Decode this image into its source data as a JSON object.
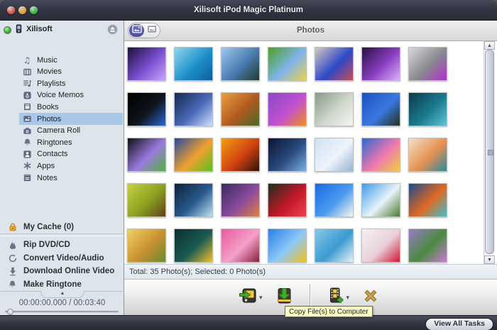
{
  "window": {
    "title": "Xilisoft iPod Magic Platinum",
    "traffic_lights": [
      {
        "name": "close",
        "color": "#e0504a"
      },
      {
        "name": "minimize",
        "color": "#dfa023"
      },
      {
        "name": "zoom",
        "color": "#35b436"
      }
    ]
  },
  "sidebar": {
    "device": {
      "name": "Xilisoft",
      "status_icon": "green-status-dot",
      "icon": "ipod-icon",
      "eject_icon": "eject-icon"
    },
    "items": [
      {
        "label": "Music",
        "icon": "music-icon",
        "selected": false
      },
      {
        "label": "Movies",
        "icon": "movies-icon",
        "selected": false
      },
      {
        "label": "Playlists",
        "icon": "playlists-icon",
        "selected": false
      },
      {
        "label": "Voice Memos",
        "icon": "voice-memos-icon",
        "selected": false
      },
      {
        "label": "Books",
        "icon": "books-icon",
        "selected": false
      },
      {
        "label": "Photos",
        "icon": "photos-icon",
        "selected": true
      },
      {
        "label": "Camera Roll",
        "icon": "camera-icon",
        "selected": false
      },
      {
        "label": "Ringtones",
        "icon": "bell-icon",
        "selected": false
      },
      {
        "label": "Contacts",
        "icon": "contacts-icon",
        "selected": false
      },
      {
        "label": "Apps",
        "icon": "apps-icon",
        "selected": false
      },
      {
        "label": "Notes",
        "icon": "notes-icon",
        "selected": false
      }
    ],
    "cache": {
      "label": "My Cache (0)",
      "icon": "lock-icon"
    },
    "tools": [
      {
        "label": "Rip DVD/CD",
        "icon": "flame-icon"
      },
      {
        "label": "Convert Video/Audio",
        "icon": "convert-icon"
      },
      {
        "label": "Download Online Video",
        "icon": "download-icon"
      },
      {
        "label": "Make Ringtone",
        "icon": "bell-icon"
      }
    ],
    "player": {
      "time": "00:00:00.000 / 00:03:40",
      "play_glyph": "▶",
      "stop_glyph": "■",
      "collapse_glyph": "▲",
      "caret_glyph": "▾"
    }
  },
  "main": {
    "view_toggle": [
      {
        "name": "photos-view",
        "selected": true
      },
      {
        "name": "camera-roll-view",
        "selected": false
      }
    ],
    "header_title": "Photos",
    "status": "Total: 35 Photo(s); Selected: 0 Photo(s)",
    "toolbar": [
      {
        "name": "copy-to-device",
        "icon": "copy-to-device-icon",
        "dropdown": true,
        "group": 1
      },
      {
        "name": "copy-to-computer",
        "icon": "copy-to-computer-icon",
        "dropdown": false,
        "group": 1
      },
      {
        "name": "add-file",
        "icon": "add-file-icon",
        "dropdown": true,
        "group": 2
      },
      {
        "name": "delete",
        "icon": "delete-icon",
        "dropdown": false,
        "group": 2
      }
    ],
    "tooltip": "Copy File(s) to Computer",
    "scrollbar": {
      "up_glyph": "▲",
      "down_glyph": "▼"
    }
  },
  "bottom_bar": {
    "view_all_tasks": "View All Tasks"
  },
  "photos": [
    {
      "name": "purple-christmas-tree",
      "colors": [
        "#1d0f3a",
        "#7a4fd0",
        "#caa6ff"
      ]
    },
    {
      "name": "tropical-beach",
      "colors": [
        "#8fd8f0",
        "#1e90c8",
        "#0a5f9e"
      ]
    },
    {
      "name": "mountain-lake",
      "colors": [
        "#9ec8ee",
        "#4a7ab0",
        "#1f3b2e"
      ]
    },
    {
      "name": "blue-butterfly",
      "colors": [
        "#4da020",
        "#7fb4ec",
        "#e8d44a"
      ]
    },
    {
      "name": "bluebird-blossoms",
      "colors": [
        "#d8c8c0",
        "#2b49c9",
        "#c84a5a"
      ]
    },
    {
      "name": "purple-butterfly-glow",
      "colors": [
        "#2a1040",
        "#8a3fc0",
        "#e0b0ff"
      ]
    },
    {
      "name": "chrome-butterfly",
      "colors": [
        "#d8d8dc",
        "#88888f",
        "#b02fd0"
      ]
    },
    {
      "name": "black-cat-blue-eyes",
      "colors": [
        "#000000",
        "#0e141c",
        "#2a6ad0"
      ]
    },
    {
      "name": "moon-fairy",
      "colors": [
        "#16284e",
        "#4a6ab8",
        "#cfe0ff"
      ]
    },
    {
      "name": "autumn-dawn",
      "colors": [
        "#e8a040",
        "#b05820",
        "#4a6a22"
      ]
    },
    {
      "name": "purple-poppies",
      "colors": [
        "#8a4ac8",
        "#c050d0",
        "#f09020"
      ]
    },
    {
      "name": "white-horse",
      "colors": [
        "#8a9a88",
        "#cfd8cc",
        "#f4f6f2"
      ]
    },
    {
      "name": "evening-field",
      "colors": [
        "#1a50c0",
        "#3a78e0",
        "#24301c"
      ]
    },
    {
      "name": "mermaid",
      "colors": [
        "#0c3a4a",
        "#1a7a8e",
        "#62c4d8"
      ]
    },
    {
      "name": "rainbow-rose",
      "colors": [
        "#101010",
        "#9a7ae0",
        "#55b040"
      ]
    },
    {
      "name": "sunrise-meadow",
      "colors": [
        "#2a4a9e",
        "#f0a030",
        "#58c020"
      ]
    },
    {
      "name": "red-sunset-bay",
      "colors": [
        "#f2a010",
        "#d04010",
        "#301408"
      ]
    },
    {
      "name": "planet-fantasy",
      "colors": [
        "#0a1430",
        "#2a4a80",
        "#7ab0e0"
      ]
    },
    {
      "name": "ice-angel",
      "colors": [
        "#cfe0f2",
        "#eef4fb",
        "#9ab4d0"
      ]
    },
    {
      "name": "cherry-blossoms",
      "colors": [
        "#2a6ad0",
        "#f078b0",
        "#f0d040"
      ]
    },
    {
      "name": "sunset-villa",
      "colors": [
        "#f0e0c8",
        "#e89050",
        "#2a8a9e"
      ]
    },
    {
      "name": "autumn-park",
      "colors": [
        "#c8d040",
        "#8aa020",
        "#604018"
      ]
    },
    {
      "name": "sparkle-fairy",
      "colors": [
        "#0e2038",
        "#2a5a8e",
        "#bfe0f0"
      ]
    },
    {
      "name": "violet-dusk",
      "colors": [
        "#3a2a5e",
        "#8a4a9e",
        "#e08040"
      ]
    },
    {
      "name": "red-rose",
      "colors": [
        "#1a3020",
        "#c01828",
        "#f04050"
      ]
    },
    {
      "name": "sky-daisy",
      "colors": [
        "#1a6ae0",
        "#4a9af0",
        "#f8f8f0"
      ]
    },
    {
      "name": "cloud-cottage",
      "colors": [
        "#3a9ae8",
        "#e8f4fc",
        "#4a7a30"
      ]
    },
    {
      "name": "mandarin-fish",
      "colors": [
        "#1a4a8e",
        "#e06820",
        "#40c0d0"
      ]
    },
    {
      "name": "golden-bride",
      "colors": [
        "#f0d060",
        "#c89030",
        "#6a8a30"
      ]
    },
    {
      "name": "yellow-butterfly",
      "colors": [
        "#0c2e30",
        "#1a5a52",
        "#f0c030"
      ]
    },
    {
      "name": "pink-tree",
      "colors": [
        "#e85a9e",
        "#f4a0c8",
        "#8a2040"
      ]
    },
    {
      "name": "sunflower-field",
      "colors": [
        "#2a80e8",
        "#8ec8f8",
        "#f0c020"
      ]
    },
    {
      "name": "waterfall",
      "colors": [
        "#88c8e8",
        "#3a9ad0",
        "#e8f4f8"
      ]
    },
    {
      "name": "roses-gift",
      "colors": [
        "#f6f0f2",
        "#e8d0da",
        "#d01830"
      ]
    },
    {
      "name": "flower-meadow",
      "colors": [
        "#9a7ac8",
        "#4a8a40",
        "#c87ad0"
      ]
    }
  ],
  "colors": {
    "selection": "#a9c7e8",
    "titlebar": "#30323f",
    "sidebar_bg": "#dee4ec",
    "tooltip_bg": "#ffffc8",
    "seg_selected": "#4c4e9e",
    "green_accent": "#3fae2a",
    "gold_accent": "#c9a04e"
  }
}
